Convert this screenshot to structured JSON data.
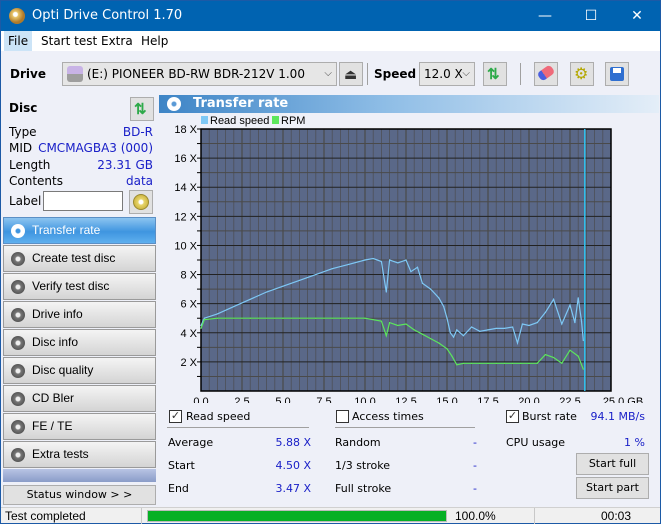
{
  "window": {
    "title": "Opti Drive Control 1.70",
    "controls": {
      "minimize": "—",
      "maximize": "☐",
      "close": "✕"
    }
  },
  "menu": {
    "items": [
      {
        "label": "File"
      },
      {
        "label": "Start test"
      },
      {
        "label": "Extra"
      },
      {
        "label": "Help"
      }
    ]
  },
  "toolbar": {
    "drive_label": "Drive",
    "drive_value": "(E:)  PIONEER BD-RW   BDR-212V 1.00",
    "speed_label": "Speed",
    "speed_value": "12.0 X",
    "icons": [
      "drive-icon",
      "eject-icon",
      "refresh-icon",
      "erase-icon",
      "settings-icon",
      "save-icon"
    ]
  },
  "disc": {
    "header": "Disc",
    "rows": [
      {
        "label": "Type",
        "value": "BD-R"
      },
      {
        "label": "MID",
        "value": "CMCMAGBA3 (000)"
      },
      {
        "label": "Length",
        "value": "23.31 GB"
      },
      {
        "label": "Contents",
        "value": "data"
      }
    ],
    "label_field_label": "Label",
    "label_field_value": ""
  },
  "nav": {
    "items": [
      {
        "label": "Transfer rate",
        "active": true
      },
      {
        "label": "Create test disc"
      },
      {
        "label": "Verify test disc"
      },
      {
        "label": "Drive info"
      },
      {
        "label": "Disc info"
      },
      {
        "label": "Disc quality"
      },
      {
        "label": "CD Bler"
      },
      {
        "label": "FE / TE"
      },
      {
        "label": "Extra tests"
      }
    ],
    "status_window": "Status window > >"
  },
  "panel": {
    "title": "Transfer rate"
  },
  "chart_data": {
    "type": "line",
    "title": "",
    "xlabel": "GB",
    "ylabel": "",
    "xlim": [
      0,
      25
    ],
    "ylim": [
      0,
      18
    ],
    "x_ticks": [
      "0.0",
      "2.5",
      "5.0",
      "7.5",
      "10.0",
      "12.5",
      "15.0",
      "17.5",
      "20.0",
      "22.5",
      "25.0 GB"
    ],
    "y_ticks": [
      "2 X",
      "4 X",
      "6 X",
      "8 X",
      "10 X",
      "12 X",
      "14 X",
      "16 X",
      "18 X"
    ],
    "grid": true,
    "legend": [
      "Read speed",
      "RPM"
    ],
    "legend_position": "top-left",
    "series": [
      {
        "name": "Read speed",
        "color": "#7ec8f5",
        "x": [
          0,
          0.2,
          1,
          2,
          3,
          4,
          5,
          6,
          7,
          8,
          9,
          10,
          10.5,
          11,
          11.3,
          11.5,
          12,
          12.5,
          12.8,
          13.2,
          13.5,
          14,
          14.5,
          14.8,
          15,
          15.2,
          15.4,
          15.6,
          16,
          16.5,
          17,
          17.5,
          18,
          18.5,
          19,
          19.3,
          19.6,
          20,
          20.5,
          21,
          21.5,
          22,
          22.5,
          22.8,
          23,
          23.2,
          23.31
        ],
        "y": [
          4.5,
          5.0,
          5.3,
          5.8,
          6.3,
          6.8,
          7.2,
          7.6,
          8.0,
          8.4,
          8.7,
          9.0,
          9.1,
          8.9,
          6.8,
          9.0,
          8.8,
          9.0,
          8.2,
          8.5,
          7.4,
          7.0,
          6.4,
          5.8,
          5.0,
          4.0,
          3.7,
          4.2,
          3.8,
          4.4,
          4.1,
          4.2,
          4.3,
          4.3,
          4.4,
          3.3,
          4.6,
          4.5,
          4.7,
          5.4,
          6.3,
          4.6,
          5.9,
          4.7,
          6.4,
          4.8,
          3.47
        ]
      },
      {
        "name": "RPM",
        "color": "#5ce65c",
        "x": [
          0,
          0.2,
          1,
          3,
          5,
          7,
          9,
          10,
          10.5,
          11,
          11.3,
          11.5,
          12,
          12.5,
          13,
          13.5,
          14,
          14.5,
          15,
          15.3,
          15.6,
          16,
          16.5,
          17,
          17.5,
          18,
          18.5,
          19,
          19.5,
          20,
          20.5,
          21,
          21.5,
          22,
          22.5,
          23,
          23.31
        ],
        "y": [
          4.3,
          4.9,
          5.0,
          5.0,
          5.0,
          5.0,
          5.0,
          5.0,
          4.9,
          4.8,
          3.8,
          4.7,
          4.5,
          4.6,
          4.2,
          3.9,
          3.6,
          3.3,
          2.9,
          2.4,
          1.8,
          1.9,
          1.9,
          1.9,
          1.9,
          1.9,
          1.9,
          1.9,
          1.9,
          1.9,
          1.9,
          2.5,
          2.3,
          1.9,
          2.8,
          2.4,
          1.5
        ]
      }
    ],
    "markers": [
      {
        "x": 23.4,
        "color": "#2fc0ea",
        "label": "end-of-disc marker"
      }
    ]
  },
  "stats": {
    "read_speed": {
      "label": "Read speed",
      "checked": true
    },
    "average": {
      "label": "Average",
      "value": "5.88 X"
    },
    "start": {
      "label": "Start",
      "value": "4.50 X"
    },
    "end": {
      "label": "End",
      "value": "3.47 X"
    },
    "access_times": {
      "label": "Access times",
      "checked": false
    },
    "random": {
      "label": "Random",
      "value": "-"
    },
    "one_third": {
      "label": "1/3 stroke",
      "value": "-"
    },
    "full_stroke": {
      "label": "Full stroke",
      "value": "-"
    },
    "burst_rate": {
      "label": "Burst rate",
      "checked": true,
      "value": "94.1 MB/s"
    },
    "cpu_usage": {
      "label": "CPU usage",
      "value": "1 %"
    },
    "start_full": "Start full",
    "start_part": "Start part"
  },
  "statusbar": {
    "text": "Test completed",
    "progress_percent": 100,
    "progress_label": "100.0%",
    "time": "00:03"
  }
}
